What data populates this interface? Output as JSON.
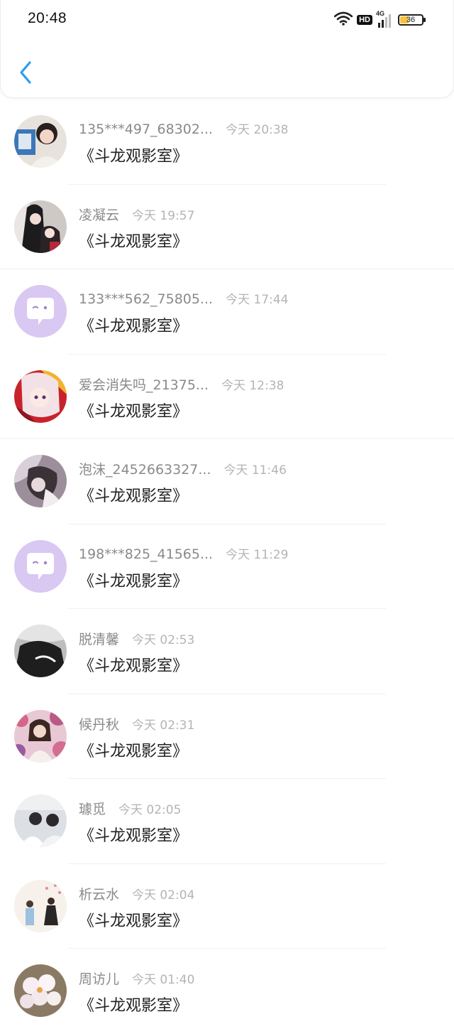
{
  "status_bar": {
    "time": "20:48",
    "hd": "HD",
    "network": "4G",
    "battery": "36"
  },
  "conversations": [
    {
      "name": "135***497_68302...",
      "time": "今天 20:38",
      "message": "《斗龙观影室》",
      "avatar": "photo"
    },
    {
      "name": "凌凝云",
      "time": "今天 19:57",
      "message": "《斗龙观影室》",
      "avatar": "photo"
    },
    {
      "name": "133***562_75805...",
      "time": "今天 17:44",
      "message": "《斗龙观影室》",
      "avatar": "default-chat"
    },
    {
      "name": "爱会消失吗_21375...",
      "time": "今天 12:38",
      "message": "《斗龙观影室》",
      "avatar": "photo"
    },
    {
      "name": "泡沫_2452663327...",
      "time": "今天 11:46",
      "message": "《斗龙观影室》",
      "avatar": "photo"
    },
    {
      "name": "198***825_41565...",
      "time": "今天 11:29",
      "message": "《斗龙观影室》",
      "avatar": "default-chat"
    },
    {
      "name": "脱清馨",
      "time": "今天 02:53",
      "message": "《斗龙观影室》",
      "avatar": "photo"
    },
    {
      "name": "候丹秋",
      "time": "今天 02:31",
      "message": "《斗龙观影室》",
      "avatar": "photo"
    },
    {
      "name": "璩觅",
      "time": "今天 02:05",
      "message": "《斗龙观影室》",
      "avatar": "photo"
    },
    {
      "name": "析云水",
      "time": "今天 02:04",
      "message": "《斗龙观影室》",
      "avatar": "photo"
    },
    {
      "name": "周访儿",
      "time": "今天 01:40",
      "message": "《斗龙观影室》",
      "avatar": "photo"
    }
  ],
  "colors": {
    "accent": "#2d9cf0",
    "default_avatar_bg": "#d9c8f2"
  }
}
